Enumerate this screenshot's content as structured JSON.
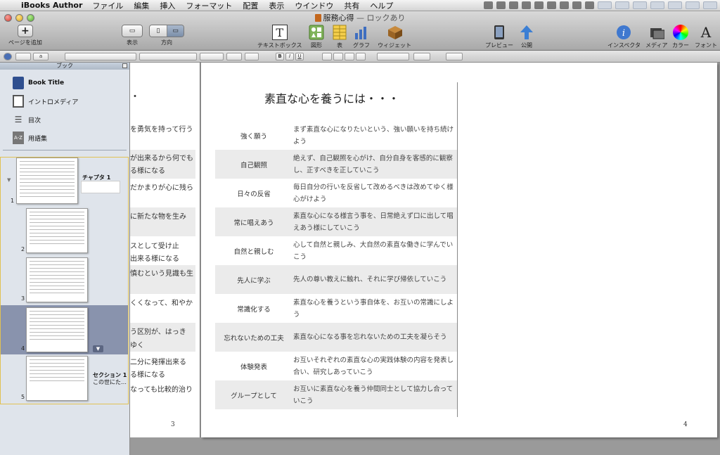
{
  "menubar": {
    "app": "iBooks Author",
    "items": [
      "ファイル",
      "編集",
      "挿入",
      "フォーマット",
      "配置",
      "表示",
      "ウインドウ",
      "共有",
      "ヘルプ"
    ]
  },
  "window": {
    "title": "服務心得",
    "title_suffix": " — ロックあり"
  },
  "toolbar": {
    "add_page": "ページを追加",
    "view": "表示",
    "orientation": "方向",
    "textbox": "テキストボックス",
    "shapes": "図形",
    "table": "表",
    "chart": "グラフ",
    "widget": "ウィジェット",
    "preview": "プレビュー",
    "publish": "公開",
    "inspector": "インスペクタ",
    "media": "メディア",
    "color": "カラー",
    "font": "フォント"
  },
  "formatbar": {
    "a_button": "a",
    "bold": "B",
    "italic": "I",
    "underline": "U"
  },
  "sidebar": {
    "header": "ブック",
    "items": [
      {
        "label": "Book Title",
        "icon": "book-icon"
      },
      {
        "label": "イントロメディア",
        "icon": "film-icon"
      },
      {
        "label": "目次",
        "icon": "list-icon"
      },
      {
        "label": "用語集",
        "icon": "glossary-icon",
        "badge": "A-Z"
      }
    ],
    "thumbs": [
      {
        "num": "1",
        "label": "チャプタ 1"
      },
      {
        "num": "2"
      },
      {
        "num": "3"
      },
      {
        "num": "4"
      },
      {
        "num": "5",
        "label": "セクション 1",
        "sub": "この世にた…"
      }
    ]
  },
  "page3": {
    "number": "3",
    "lines": [
      "・",
      "を勇気を持って行う",
      "が出来るから何でも",
      "る様になる",
      "だかまりが心に残ら",
      "に新たな物を生み",
      "スとして受け止",
      "出来る様になる",
      "慎むという見識も生",
      "くくなって、和やか",
      "う区別が、はっき",
      "ゆく",
      "二分に発揮出来る",
      "る様になる",
      "なっても比較的治り"
    ]
  },
  "page4": {
    "number": "4",
    "title": "素直な心を養うには・・・",
    "rows": [
      {
        "label": "強く願う",
        "text": "まず素直な心になりたいという、強い願いを持ち続けよう"
      },
      {
        "label": "自己観照",
        "text": "絶えず、自己観照を心がけ、自分自身を客感的に観察し、正すべきを正していこう"
      },
      {
        "label": "日々の反省",
        "text": "毎日自分の行いを反省して改めるべきは改めてゆく様心がけよう"
      },
      {
        "label": "常に唱えあう",
        "text": "素直な心になる様言う事を、日常絶えず口に出して唱えあう様にしていこう"
      },
      {
        "label": "自然と親しむ",
        "text": "心して自然と親しみ、大自然の素直な働きに学んでいこう"
      },
      {
        "label": "先人に学ぶ",
        "text": "先人の尊い教えに触れ、それに学び帰依していこう"
      },
      {
        "label": "常識化する",
        "text": "素直な心を養うという事自体を、お互いの常識にしよう"
      },
      {
        "label": "忘れないための工夫",
        "text": "素直な心になる事を忘れないための工夫を凝らそう"
      },
      {
        "label": "体験発表",
        "text": "お互いそれぞれの素直な心の実践体験の内容を発表し合い、研究しあっていこう"
      },
      {
        "label": "グループとして",
        "text": "お互いに素直な心を養う仲間同士として協力し合っていこう"
      }
    ]
  }
}
